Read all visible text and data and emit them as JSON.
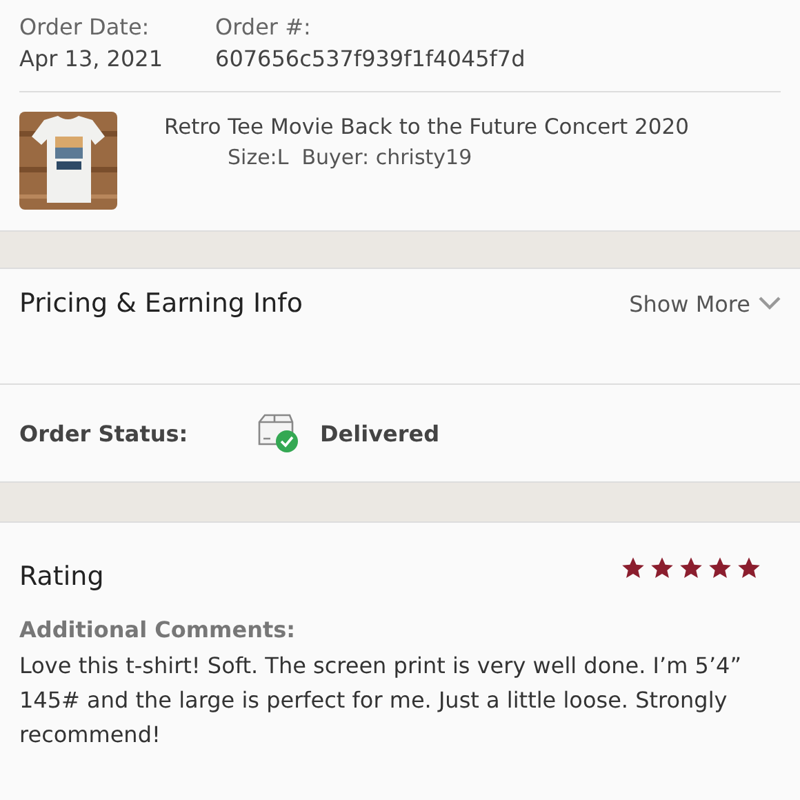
{
  "order": {
    "date_label": "Order Date:",
    "date": "Apr 13, 2021",
    "number_label": "Order #:",
    "number": "607656c537f939f1f4045f7d"
  },
  "item": {
    "title": "Retro Tee Movie Back to the Future Concert 2020",
    "size": "Size:L",
    "buyer": "Buyer: christy19"
  },
  "pricing": {
    "title": "Pricing & Earning Info",
    "toggle": "Show More",
    "expanded": false
  },
  "status": {
    "label": "Order Status:",
    "value": "Delivered",
    "delivered": true
  },
  "rating": {
    "title": "Rating",
    "stars": 5,
    "comments_label": "Additional Comments:",
    "comments": "Love this t-shirt! Soft. The screen print is very well done. I’m 5’4” 145# and the large is perfect for me. Just a little loose. Strongly recommend!"
  }
}
